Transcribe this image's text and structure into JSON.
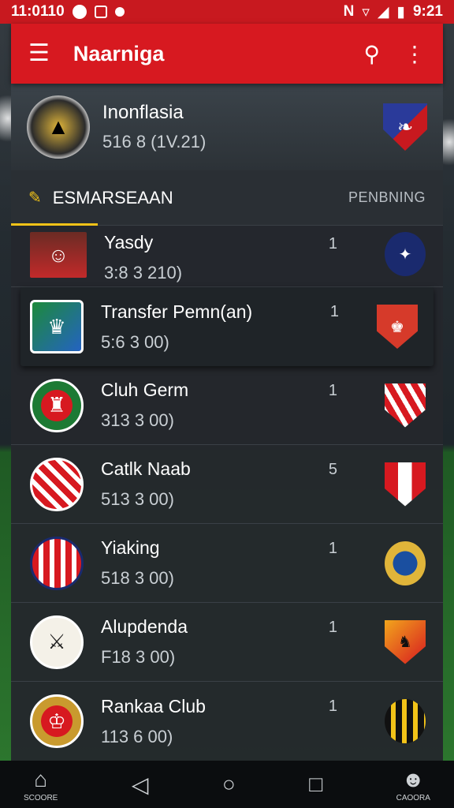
{
  "status_bar": {
    "time_left": "11:0110",
    "time_right": "9:21",
    "network": "N"
  },
  "app_bar": {
    "title": "Naarniga"
  },
  "match": {
    "team": "Inonflasia",
    "score": "516 8 (1V.21)"
  },
  "tabs": {
    "active_label": "ESMARSEAAN",
    "other_label": "PENBNING"
  },
  "list": [
    {
      "team": "Yasdy",
      "time": "3:8 3 210)",
      "count": "1"
    },
    {
      "team": "Transfer Pemn(an)",
      "time": "5:6 3 00)",
      "count": "1"
    },
    {
      "team": "Cluh Germ",
      "time": "313 3 00)",
      "count": "1"
    },
    {
      "team": "Catlk Naab",
      "time": "513 3 00)",
      "count": "5"
    },
    {
      "team": "Yiaking",
      "time": "518 3 00)",
      "count": "1"
    },
    {
      "team": "Alupdenda",
      "time": "F18 3 00)",
      "count": "1"
    },
    {
      "team": "Rankaa Club",
      "time": "113 6 00)",
      "count": "1"
    }
  ],
  "nav": {
    "home_label": "SCOORE",
    "profile_label": "CAOORA"
  },
  "colors": {
    "primary_red": "#d71920",
    "accent_yellow": "#f2c318",
    "panel_bg": "#24282d"
  }
}
